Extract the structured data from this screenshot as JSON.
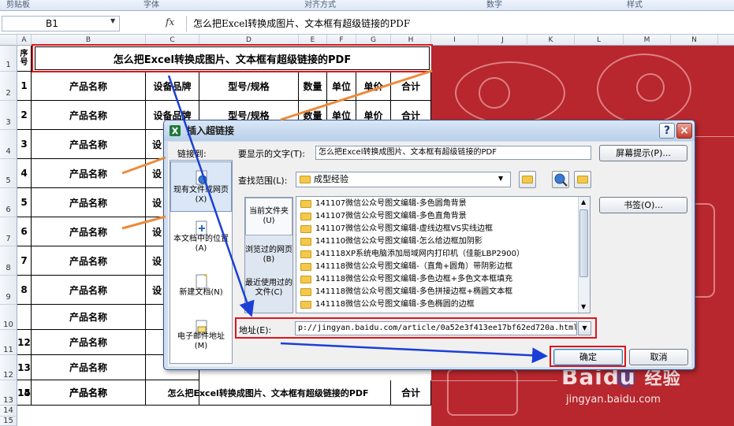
{
  "ribbon": {
    "groups": [
      "剪贴板",
      "字体",
      "对齐方式",
      "数字",
      "样式"
    ]
  },
  "formula_bar": {
    "name_box": "B1",
    "fx_label": "fx",
    "content": "怎么把Excel转换成图片、文本框有超级链接的PDF"
  },
  "sheet": {
    "columns": [
      "A",
      "B",
      "C",
      "D",
      "E",
      "F",
      "G",
      "H",
      "I",
      "J",
      "K",
      "L",
      "M",
      "N"
    ],
    "rows": [
      "1",
      "2",
      "3",
      "4",
      "5",
      "6",
      "7",
      "8",
      "9",
      "10",
      "11",
      "12",
      "13",
      "14",
      "15"
    ],
    "title": "怎么把Excel转换成图片、文本框有超级链接的PDF",
    "a1_label": "序号",
    "header_row": [
      "1",
      "产品名称",
      "设备品牌",
      "型号/规格",
      "数量",
      "单位",
      "单价",
      "合计"
    ],
    "row2": [
      "2",
      "产品名称",
      "设备品牌",
      "型号/规格",
      "数量",
      "单位",
      "单价",
      "合计"
    ],
    "row_numbers": [
      "3",
      "4",
      "5",
      "6",
      "7",
      "8",
      "9",
      "",
      "12",
      "13",
      "14",
      "15"
    ],
    "product_name": "产品名称",
    "brand_stub": "设",
    "last_row_center": "怎么把Excel转换成图片、文本框有超级链接的PDF",
    "last_row_total": "合计"
  },
  "watermark": {
    "brand": "Baidu",
    "brand_cn": "经验",
    "url": "jingyan.baidu.com"
  },
  "dialog": {
    "title": "插入超链接",
    "help": "?",
    "close": "×",
    "link_to_label": "链接到:",
    "link_to": [
      {
        "label": "现有文件或网页(X)"
      },
      {
        "label": "本文档中的位置(A)"
      },
      {
        "label": "新建文档(N)"
      },
      {
        "label": "电子邮件地址(M)"
      }
    ],
    "text_to_display_label": "要显示的文字(T):",
    "text_to_display": "怎么把Excel转换成图片、文本框有超级链接的PDF",
    "screentip_button": "屏幕提示(P)...",
    "look_in_label": "查找范围(L):",
    "look_in_value": "成型经验",
    "bookmark_button": "书签(O)...",
    "side_tabs": [
      {
        "label": "当前文件夹(U)"
      },
      {
        "label": "浏览过的网页(B)"
      },
      {
        "label": "最近使用过的文件(C)"
      }
    ],
    "files": [
      "141107微信公众号图文编辑-多色圆角背景",
      "141107微信公众号图文编辑-多色直角背景",
      "141107微信公众号图文编辑-虚线边框VS实线边框",
      "141110微信公众号图文编辑-怎么给边框加阴影",
      "141118XP系统电脑添加局域网内打印机（佳能LBP2900）",
      "141118微信公众号图文编辑-（直角+圆角）带阴影边框",
      "141118微信公众号图文编辑-多色边框+多色文本框填充",
      "141118微信公众号图文编辑-多色拼接边框+椭圆文本框",
      "141118微信公众号图文编辑-多色椭圆的边框"
    ],
    "address_label": "地址(E):",
    "address": "p://jingyan.baidu.com/article/0a52e3f413ee17bf62ed720a.html",
    "ok_button": "确定",
    "cancel_button": "取消"
  }
}
